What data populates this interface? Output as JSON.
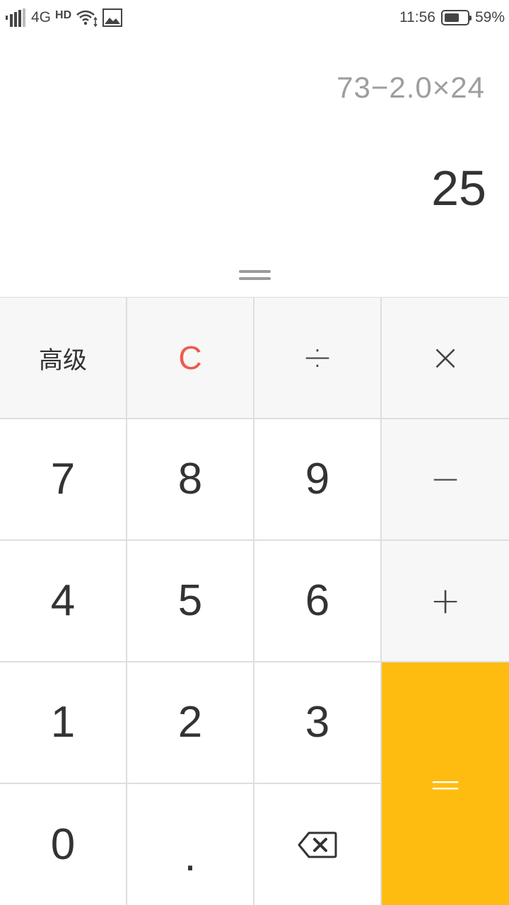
{
  "status_bar": {
    "network": "4G",
    "hd": "HD",
    "time": "11:56",
    "battery": "59%",
    "icons": [
      "signal-icon",
      "wifi-icon",
      "gallery-icon",
      "battery-icon"
    ]
  },
  "display": {
    "expression": "73−2.0×24",
    "result": "25"
  },
  "keys": {
    "advanced": "高级",
    "clear": "C",
    "divide": "÷",
    "multiply": "×",
    "minus": "−",
    "plus": "+",
    "equals": "=",
    "dot": ".",
    "digits": {
      "d0": "0",
      "d1": "1",
      "d2": "2",
      "d3": "3",
      "d4": "4",
      "d5": "5",
      "d6": "6",
      "d7": "7",
      "d8": "8",
      "d9": "9"
    },
    "backspace_icon": "backspace-icon"
  },
  "colors": {
    "equals_bg": "#ffbc10",
    "clear_text": "#f0594b",
    "operator_bg": "#f7f7f7"
  }
}
